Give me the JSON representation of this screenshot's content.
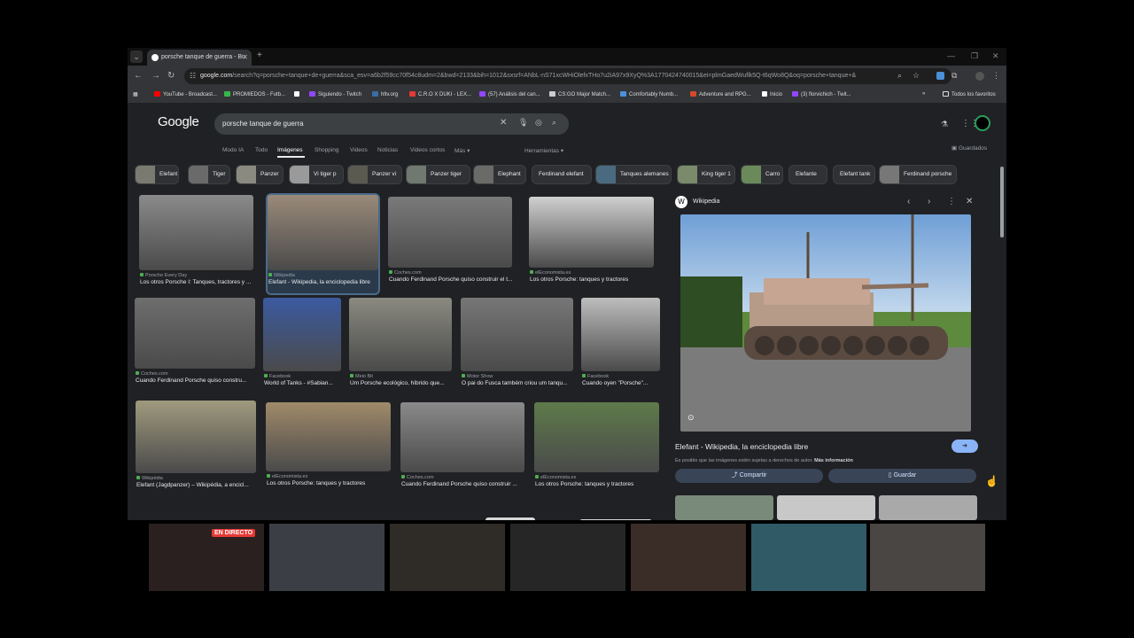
{
  "browser": {
    "tab_title": "porsche tanque de guerra - Bu",
    "url_host": "google.com",
    "url_path": "/search?q=porsche+tanque+de+guerra&sca_esv=a6b2f59cc70f54c8udm=2&bwd=2133&bih=1012&sxsrf=ANbL-nS71xcWHiOlefxTHo7u2iA97x9XyQ%3A1770424740015&ei=plmGaedWuflk5Q-t6qWo8Q&oq=porsche+tanque+&",
    "bookmarks": [
      {
        "label": "YouTube - Broadcast...",
        "color": "#ff0000"
      },
      {
        "label": "PROMIEDOS - Futb...",
        "color": "#3ab54a"
      },
      {
        "label": "",
        "color": "#ffffff"
      },
      {
        "label": "Siguiendo - Twitch",
        "color": "#9146ff"
      },
      {
        "label": "hltv.org",
        "color": "#3a6ea5"
      },
      {
        "label": "C.R.O X DUKI - LEX...",
        "color": "#e53935"
      },
      {
        "label": "(57) Análisis del can...",
        "color": "#9146ff"
      },
      {
        "label": "CS:GO Major Match...",
        "color": "#cccccc"
      },
      {
        "label": "Comfortably Numb...",
        "color": "#4a90d9"
      },
      {
        "label": "Adventure and RPG...",
        "color": "#d44a2a"
      },
      {
        "label": "Inicio",
        "color": "#ffffff"
      },
      {
        "label": "(3) florvichich - Twit...",
        "color": "#9146ff"
      }
    ],
    "bookmarks_right": "Todos los favoritos"
  },
  "google": {
    "logo": "Google",
    "query": "porsche tanque de guerra",
    "nav_tabs": [
      "Modo IA",
      "Todo",
      "Imágenes",
      "Shopping",
      "Videos",
      "Noticias",
      "Videos cortos",
      "Más"
    ],
    "active_tab": "Imágenes",
    "tools": "Herramientas",
    "saved": "Guardados"
  },
  "chips": [
    {
      "label": "Elefant",
      "thumb": true
    },
    {
      "label": "Tiger",
      "thumb": true
    },
    {
      "label": "Panzer",
      "thumb": true
    },
    {
      "label": "Vi tiger p",
      "thumb": true
    },
    {
      "label": "Panzer vi",
      "thumb": true
    },
    {
      "label": "Panzer tiger",
      "thumb": true
    },
    {
      "label": "Elephant",
      "thumb": true
    },
    {
      "label": "Ferdinand elefant",
      "thumb": false
    },
    {
      "label": "Tanques alemanes",
      "thumb": true
    },
    {
      "label": "King tiger 1",
      "thumb": true
    },
    {
      "label": "Carro",
      "thumb": true
    },
    {
      "label": "Elefante",
      "thumb": false
    },
    {
      "label": "Elefant tank",
      "thumb": false
    },
    {
      "label": "Ferdinand porsche",
      "thumb": true
    }
  ],
  "results": [
    {
      "source": "Porsche Every Day",
      "title": "Los otros Porsche I: Tanques, tractores y ...",
      "color": "#8a8a8a"
    },
    {
      "source": "Wikipedia",
      "title": "Elefant - Wikipedia, la enciclopedia libre",
      "color": "#9a8a7a"
    },
    {
      "source": "Coches.com",
      "title": "Cuando Ferdinand Porsche quiso construir el t...",
      "color": "#7a7a7a"
    },
    {
      "source": "elEconomista.es",
      "title": "Los otros Porsche: tanques y tractores",
      "color": "#d0d0d0"
    },
    {
      "source": "Coches.com",
      "title": "Cuando Ferdinand Porsche quiso constru...",
      "color": "#6e6e6e"
    },
    {
      "source": "Facebook",
      "title": "World of Tanks - #Sabian...",
      "color": "#3b5aa0"
    },
    {
      "source": "Meio Bit",
      "title": "Um Porsche ecológico, híbrido que...",
      "color": "#8a8a80"
    },
    {
      "source": "Motor Show",
      "title": "O pai do Fusca também criou um tanqu...",
      "color": "#777777"
    },
    {
      "source": "Facebook",
      "title": "Cuando oyen \"Porsche\"...",
      "color": "#bdbdbd"
    },
    {
      "source": "Wikipédia",
      "title": "Elefant (Jagdpanzer) – Wikipédia, a encicl...",
      "color": "#a09a7e"
    },
    {
      "source": "elEconomista.es",
      "title": "Los otros Porsche: tanques y tractores",
      "color": "#a08a6a"
    },
    {
      "source": "Coches.com",
      "title": "Cuando Ferdinand Porsche quiso construir ...",
      "color": "#8a8a8a"
    },
    {
      "source": "elEconomista.es",
      "title": "Los otros Porsche: tanques y tractores",
      "color": "#5e7a4a"
    }
  ],
  "panel": {
    "site": "Wikipedia",
    "title": "Elefant - Wikipedia, la enciclopedia libre",
    "note": "Es posible que las imágenes estén sujetas a derechos de autor.",
    "note_link": "Más información",
    "share": "Compartir",
    "save": "Guardar"
  },
  "stream": {
    "live_badge": "EN DIRECTO"
  }
}
